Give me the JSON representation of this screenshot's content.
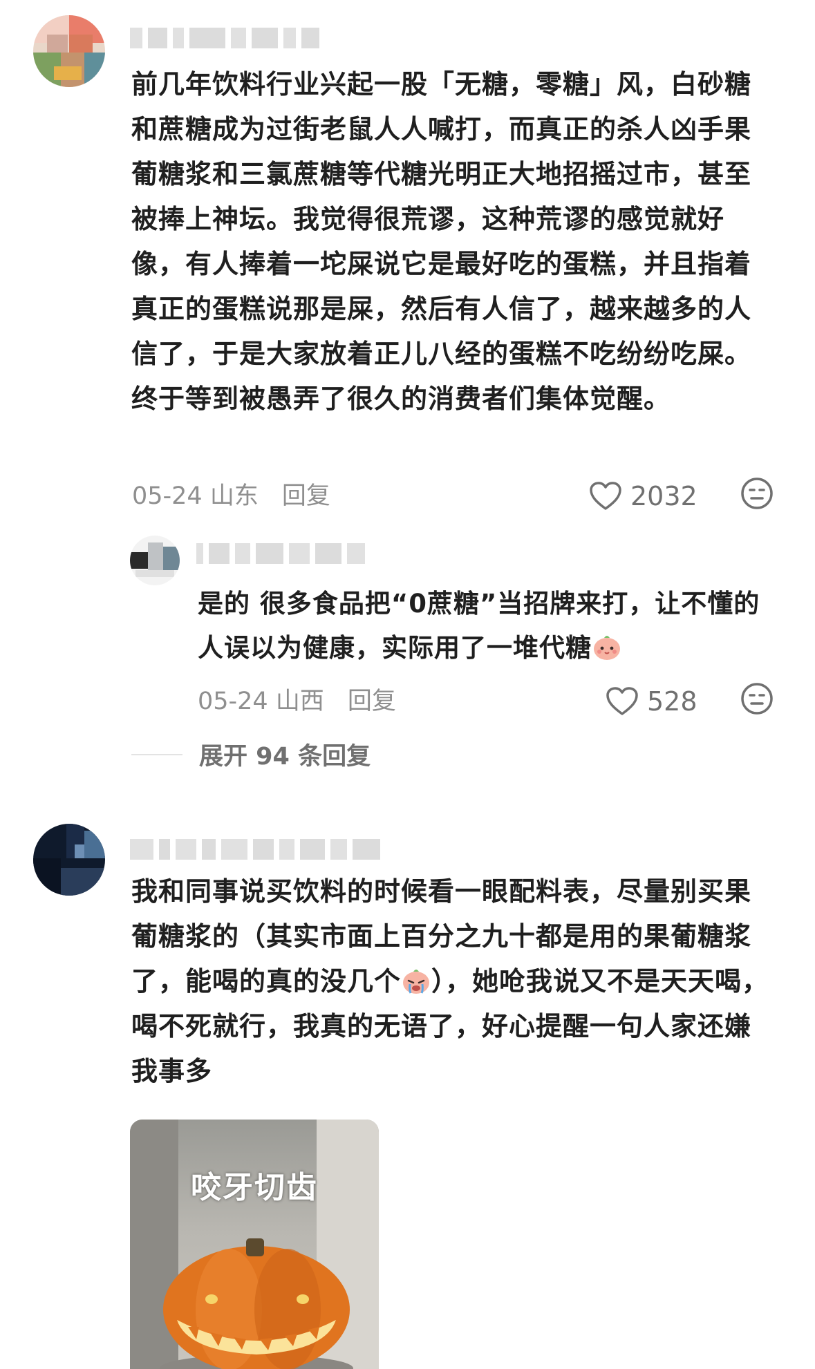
{
  "comments": [
    {
      "text": "前几年饮料行业兴起一股「无糖，零糖」风，白砂糖和蔗糖成为过街老鼠人人喊打，而真正的杀人凶手果葡糖浆和三氯蔗糖等代糖光明正大地招摇过市，甚至被捧上神坛。我觉得很荒谬，这种荒谬的感觉就好像，有人捧着一坨屎说它是最好吃的蛋糕，并且指着真正的蛋糕说那是屎，然后有人信了，越来越多的人信了，于是大家放着正儿八经的蛋糕不吃纷纷吃屎。终于等到被愚弄了很久的消费者们集体觉醒。",
      "date": "05-24",
      "location": "山东",
      "reply_label": "回复",
      "likes": "2032",
      "replies": [
        {
          "text": "是的 很多食品把“0蔗糖”当招牌来打，让不懂的人误以为健康，实际用了一堆代糖",
          "date": "05-24",
          "location": "山西",
          "reply_label": "回复",
          "likes": "528"
        }
      ],
      "expand_label": "展开 94 条回复"
    },
    {
      "text_before_emoji": "我和同事说买饮料的时候看一眼配料表，尽量别买果葡糖浆的（其实市面上百分之九十都是用的果葡糖浆了，能喝的真的没几个",
      "text_after_emoji": "），她呛我说又不是天天喝，喝不死就行，我真的无语了，好心提醒一句人家还嫌我事多",
      "sticker_caption": "咬牙切齿"
    }
  ],
  "icons": {
    "like": "heart-outline-icon",
    "dislike": "meh-face-icon",
    "reply_emoji": "pink-face-emoji",
    "crying_emoji": "crying-face-emoji"
  },
  "colors": {
    "text": "#1f1f1f",
    "meta": "#8f8f8f",
    "background": "#ffffff"
  }
}
